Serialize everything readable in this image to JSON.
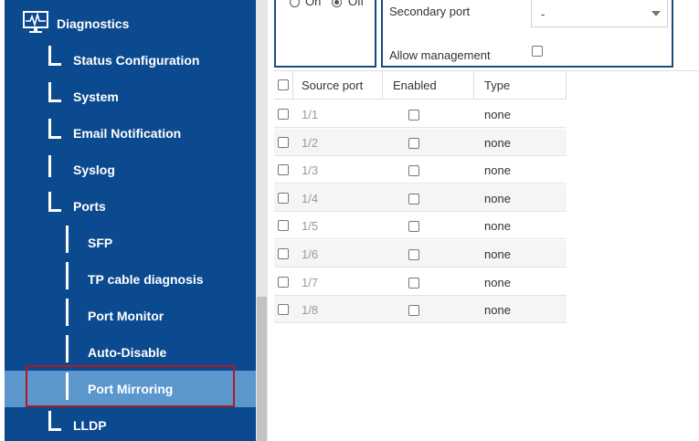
{
  "sidebar": {
    "items": [
      {
        "label": "Diagnostics"
      },
      {
        "label": "Status Configuration"
      },
      {
        "label": "System"
      },
      {
        "label": "Email Notification"
      },
      {
        "label": "Syslog"
      },
      {
        "label": "Ports"
      },
      {
        "label": "SFP"
      },
      {
        "label": "TP cable diagnosis"
      },
      {
        "label": "Port Monitor"
      },
      {
        "label": "Auto-Disable"
      },
      {
        "label": "Port Mirroring",
        "selected": true
      },
      {
        "label": "LLDP"
      }
    ],
    "colors": {
      "background": "#0c4a8f",
      "selected": "#5b97cd",
      "highlight_outline": "#b1191f"
    }
  },
  "mirroring": {
    "on_label": "On",
    "off_label": "Off",
    "selected": "Off",
    "secondary_port_label": "Secondary port",
    "secondary_port_value": "-",
    "allow_management_label": "Allow management",
    "allow_management_checked": false
  },
  "table": {
    "headers": {
      "source_port": "Source port",
      "enabled": "Enabled",
      "type": "Type"
    },
    "rows": [
      {
        "port": "1/1",
        "enabled": false,
        "type": "none"
      },
      {
        "port": "1/2",
        "enabled": false,
        "type": "none"
      },
      {
        "port": "1/3",
        "enabled": false,
        "type": "none"
      },
      {
        "port": "1/4",
        "enabled": false,
        "type": "none"
      },
      {
        "port": "1/5",
        "enabled": false,
        "type": "none"
      },
      {
        "port": "1/6",
        "enabled": false,
        "type": "none"
      },
      {
        "port": "1/7",
        "enabled": false,
        "type": "none"
      },
      {
        "port": "1/8",
        "enabled": false,
        "type": "none"
      }
    ]
  }
}
